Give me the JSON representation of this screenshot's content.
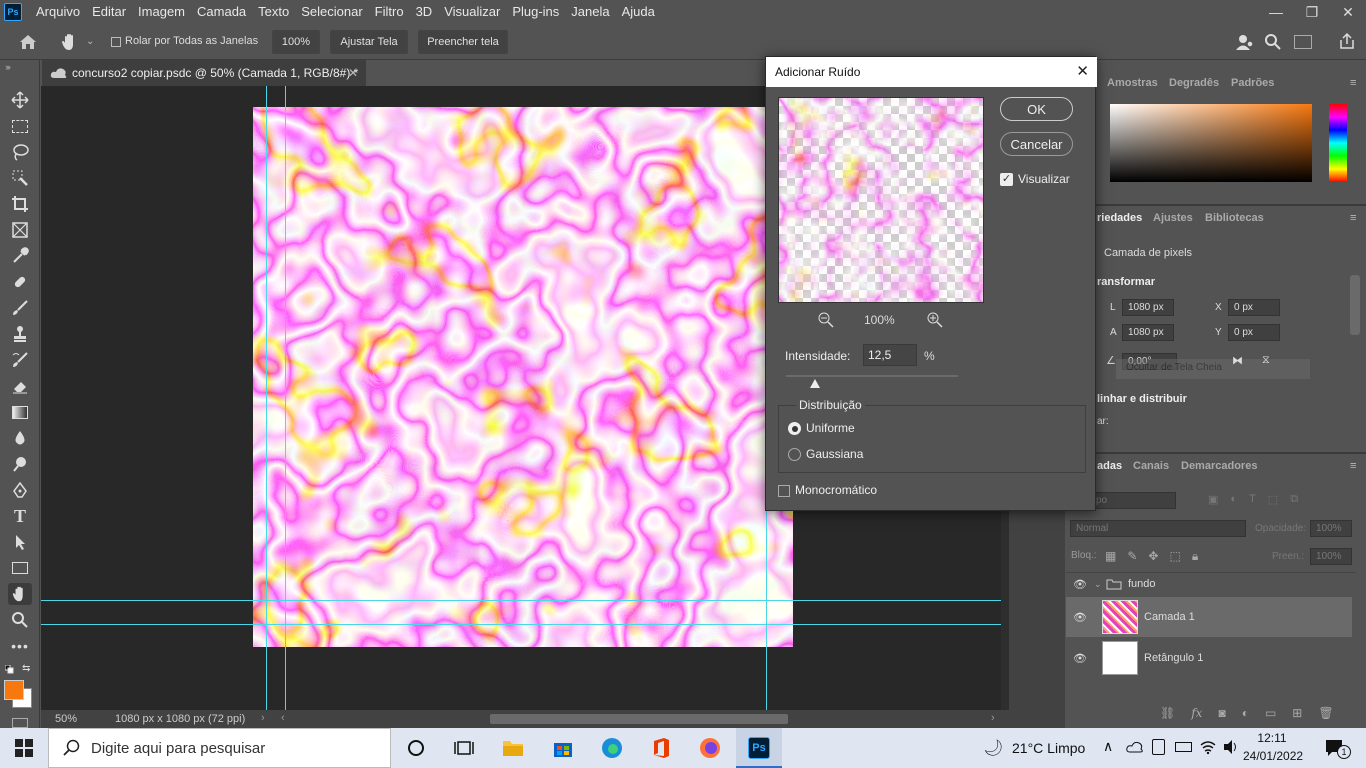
{
  "app": {
    "logo": "Ps",
    "window_controls": [
      "—",
      "❐",
      "✕"
    ]
  },
  "menu": [
    "Arquivo",
    "Editar",
    "Imagem",
    "Camada",
    "Texto",
    "Selecionar",
    "Filtro",
    "3D",
    "Visualizar",
    "Plug-ins",
    "Janela",
    "Ajuda"
  ],
  "options_bar": {
    "scroll_all_windows": "Rolar por Todas as Janelas",
    "zoom": "100%",
    "fit_screen": "Ajustar Tela",
    "fill_screen": "Preencher tela"
  },
  "document": {
    "tab_title": "concurso2 copiar.psdc @ 50% (Camada 1, RGB/8#) *",
    "zoom": "50%",
    "size": "1080 px x 1080 px (72 ppi)"
  },
  "colors": {
    "foreground": "#f7780f",
    "background": "#ffffff",
    "guide": "#4ad7e8",
    "accent": "#31a8ff"
  },
  "panels": {
    "swatches_tabs": [
      "Amostras",
      "Degradês",
      "Padrões"
    ],
    "properties_tabs": [
      "riedades",
      "Ajustes",
      "Bibliotecas"
    ],
    "properties": {
      "layer_type": "Camada de pixels",
      "transform_title": "ransformar",
      "w_label": "L",
      "w_value": "1080 px",
      "x_label": "X",
      "x_value": "0 px",
      "h_label": "A",
      "h_value": "1080 px",
      "y_label": "Y",
      "y_value": "0 px",
      "angle": "0,00°",
      "tooltip": "Ocultar de Tela Cheia",
      "align_title": "linhar e distribuir",
      "align_sub": "ar:"
    },
    "layers_tabs": [
      "adas",
      "Canais",
      "Demarcadores"
    ],
    "layers": {
      "kind_placeholder": "po",
      "blend_mode": "Normal",
      "opacity_label": "Opacidade:",
      "opacity": "100%",
      "lock_label": "Bloq.:",
      "fill_label": "Preen.:",
      "fill": "100%",
      "items": [
        {
          "name": "fundo"
        },
        {
          "name": "Camada 1"
        },
        {
          "name": "Retângulo 1"
        }
      ]
    }
  },
  "dialog": {
    "title": "Adicionar Ruído",
    "ok": "OK",
    "cancel": "Cancelar",
    "preview_label": "Visualizar",
    "preview_zoom": "100%",
    "amount_label": "Intensidade:",
    "amount_value": "12,5",
    "amount_unit": "%",
    "amount_slider_fraction": 0.17,
    "distribution_label": "Distribuição",
    "uniform": "Uniforme",
    "gaussian": "Gaussiana",
    "monochromatic": "Monocromático"
  },
  "taskbar": {
    "search_placeholder": "Digite aqui para pesquisar",
    "weather": "21°C  Limpo",
    "time": "12:11",
    "date": "24/01/2022",
    "notifications": "1"
  }
}
